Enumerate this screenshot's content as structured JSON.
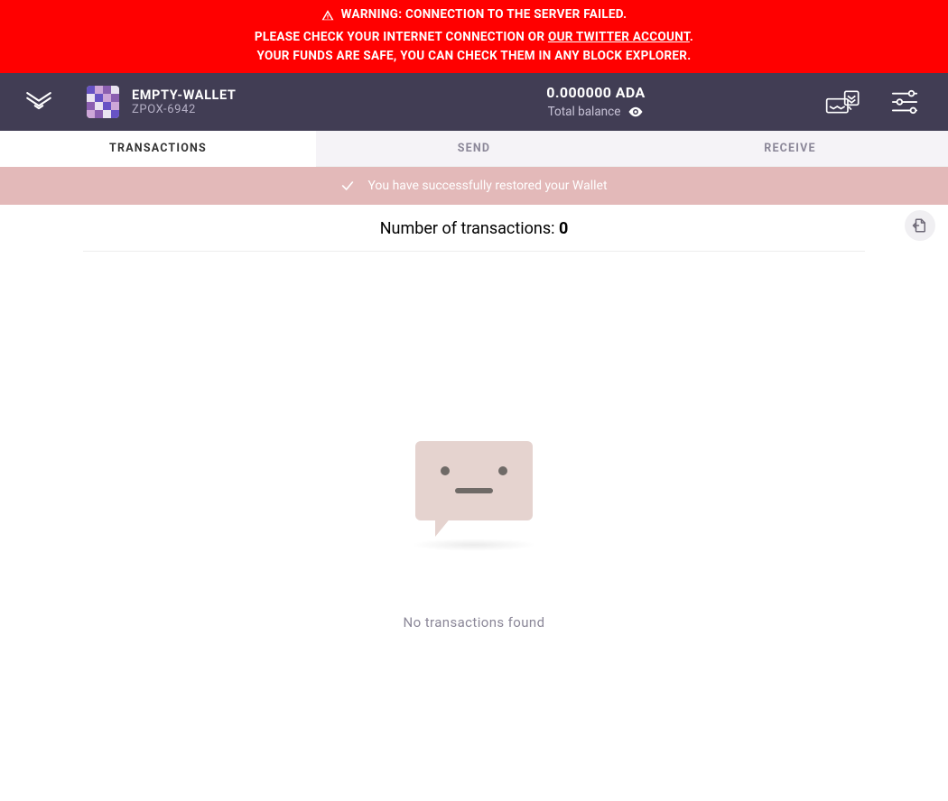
{
  "banner": {
    "line1": "WARNING: CONNECTION TO THE SERVER FAILED.",
    "line2_pre": "PLEASE CHECK YOUR INTERNET CONNECTION OR ",
    "line2_link": "OUR TWITTER ACCOUNT",
    "line2_post": ".",
    "line3": "YOUR FUNDS ARE SAFE, YOU CAN CHECK THEM IN ANY BLOCK EXPLORER."
  },
  "header": {
    "wallet_name": "EMPTY-WALLET",
    "wallet_id": "ZPOX-6942",
    "balance_amount": "0.000000 ADA",
    "balance_label": "Total balance"
  },
  "tabs": {
    "transactions": "TRANSACTIONS",
    "send": "SEND",
    "receive": "RECEIVE",
    "active": "transactions"
  },
  "success": {
    "message": "You have successfully restored your Wallet"
  },
  "content": {
    "tx_count_label": "Number of transactions: ",
    "tx_count_value": "0",
    "empty_message": "No transactions found"
  },
  "icons": {
    "app_logo": "yoroi-logo-icon",
    "warning": "warning-triangle-icon",
    "eye": "eye-icon",
    "paper_wallets": "paper-wallets-icon",
    "settings_sliders": "settings-sliders-icon",
    "check": "check-icon",
    "export": "export-file-icon"
  },
  "colors": {
    "banner_bg": "#ff0000",
    "header_bg": "#413d54",
    "success_bg": "#e3b9b9",
    "accent_rail": "#e6a6a6"
  }
}
